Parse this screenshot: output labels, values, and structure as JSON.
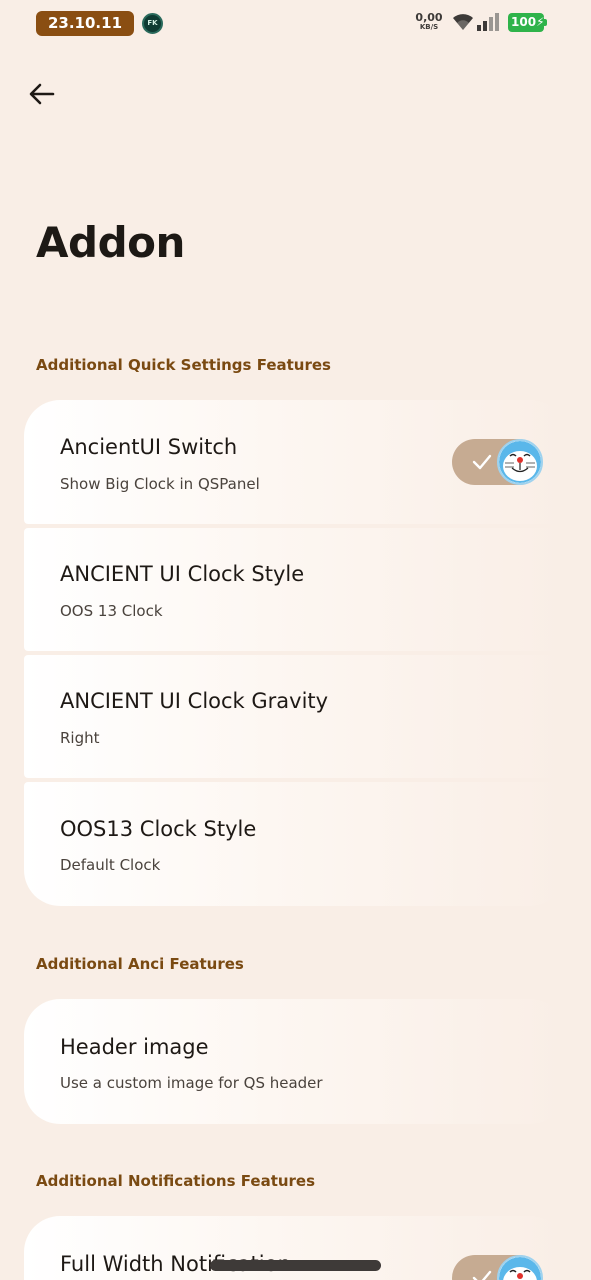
{
  "status_bar": {
    "date": "23.10.11",
    "app_icon_text": "FK",
    "net_speed_value": "0,00",
    "net_speed_unit": "KB/S",
    "battery": "100"
  },
  "page": {
    "title": "Addon"
  },
  "sections": [
    {
      "header": "Additional Quick Settings Features",
      "items": [
        {
          "title": "AncientUI Switch",
          "subtitle": "Show Big Clock in QSPanel",
          "toggle": true
        },
        {
          "title": "ANCIENT UI Clock Style",
          "subtitle": "OOS 13 Clock"
        },
        {
          "title": "ANCIENT UI Clock Gravity",
          "subtitle": "Right"
        },
        {
          "title": "OOS13 Clock Style",
          "subtitle": "Default Clock"
        }
      ]
    },
    {
      "header": "Additional Anci Features",
      "items": [
        {
          "title": "Header image",
          "subtitle": "Use a custom image for QS header"
        }
      ]
    },
    {
      "header": "Additional Notifications Features",
      "items": [
        {
          "title": "Full Width Notification",
          "toggle": true
        }
      ]
    }
  ],
  "colors": {
    "background": "#f9eee6",
    "accent": "#7a4a12",
    "date_pill": "#8a4e12",
    "toggle_track": "#c6ab92",
    "battery": "#2fb34a"
  },
  "icons": [
    "back-arrow-icon",
    "wifi-icon",
    "signal-icon",
    "battery-icon",
    "check-icon",
    "doraemon-thumb-icon"
  ]
}
